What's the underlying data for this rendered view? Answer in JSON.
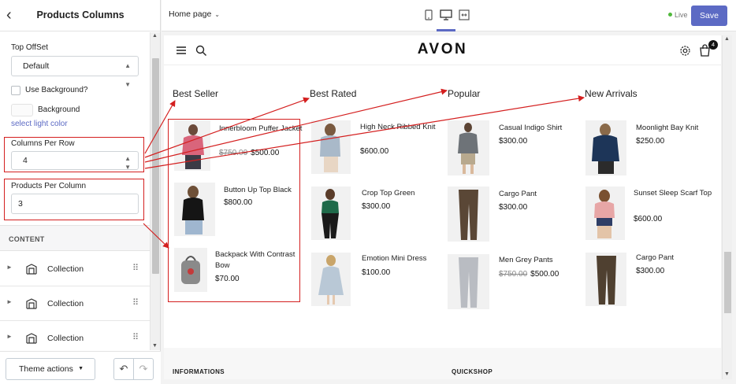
{
  "panel": {
    "back_icon": "chevron-left-icon",
    "title": "Products Columns",
    "top_offset_label": "Top OffSet",
    "top_offset_value": "Default",
    "use_background_label": "Use Background?",
    "background_label": "Background",
    "select_color_link": "select light color",
    "columns_per_row_label": "Columns Per Row",
    "columns_per_row_value": "4",
    "products_per_column_label": "Products Per Column",
    "products_per_column_value": "3",
    "content_header": "CONTENT",
    "collections": [
      {
        "label": "Collection",
        "icon": "collection-icon"
      },
      {
        "label": "Collection",
        "icon": "collection-icon"
      },
      {
        "label": "Collection",
        "icon": "collection-icon"
      }
    ],
    "theme_actions": "Theme actions",
    "undo_icon": "undo-icon",
    "redo_icon": "redo-icon"
  },
  "topbar": {
    "page": "Home page",
    "devices": [
      "mobile-icon",
      "desktop-icon",
      "fullscreen-icon"
    ],
    "status": "Live",
    "save": "Save"
  },
  "store": {
    "logo": "AVON",
    "cart_count": "4",
    "sections": [
      {
        "title": "Best Seller",
        "products": [
          {
            "name": "Innerbloom Puffer Jacket",
            "old_price": "$750.00",
            "price": "$500.00"
          },
          {
            "name": "Button Up Top Black",
            "old_price": "",
            "price": "$800.00"
          },
          {
            "name": "Backpack With Contrast Bow",
            "old_price": "",
            "price": "$70.00"
          }
        ]
      },
      {
        "title": "Best Rated",
        "products": [
          {
            "name": "High Neck Ribbed Knit",
            "old_price": "",
            "price": "$600.00"
          },
          {
            "name": "Crop Top Green",
            "old_price": "",
            "price": "$300.00"
          },
          {
            "name": "Emotion Mini Dress",
            "old_price": "",
            "price": "$100.00"
          }
        ]
      },
      {
        "title": "Popular",
        "products": [
          {
            "name": "Casual Indigo Shirt",
            "old_price": "",
            "price": "$300.00"
          },
          {
            "name": "Cargo Pant",
            "old_price": "",
            "price": "$300.00"
          },
          {
            "name": "Men Grey Pants",
            "old_price": "$750.00",
            "price": "$500.00"
          }
        ]
      },
      {
        "title": "New Arrivals",
        "products": [
          {
            "name": "Moonlight Bay Knit",
            "old_price": "",
            "price": "$250.00"
          },
          {
            "name": "Sunset Sleep Scarf Top",
            "old_price": "",
            "price": "$600.00"
          },
          {
            "name": "Cargo Pant",
            "old_price": "",
            "price": "$300.00"
          }
        ]
      }
    ],
    "footer": [
      "INFORMATIONS",
      "QUICKSHOP"
    ]
  },
  "colors": {
    "accent": "#5c6ac4",
    "annotation": "#d41f1f",
    "live": "#50b83c"
  }
}
